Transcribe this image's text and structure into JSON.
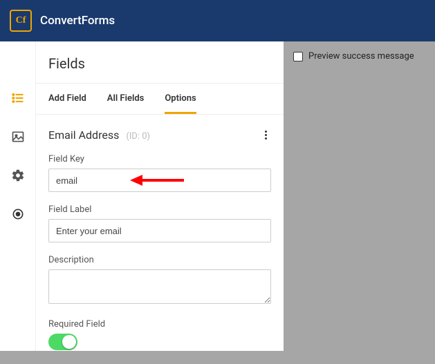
{
  "brand": "ConvertForms",
  "logo_text": "Cf",
  "panel": {
    "title": "Fields"
  },
  "tabs": [
    {
      "label": "Add Field",
      "active": false
    },
    {
      "label": "All Fields",
      "active": false
    },
    {
      "label": "Options",
      "active": true
    }
  ],
  "section": {
    "title": "Email Address",
    "id_label": "(ID: 0)"
  },
  "fields": {
    "field_key": {
      "label": "Field Key",
      "value": "email"
    },
    "field_label": {
      "label": "Field Label",
      "value": "Enter your email"
    },
    "description": {
      "label": "Description",
      "value": ""
    },
    "required": {
      "label": "Required Field",
      "on": true
    }
  },
  "preview": {
    "checkbox_label": "Preview success message"
  }
}
